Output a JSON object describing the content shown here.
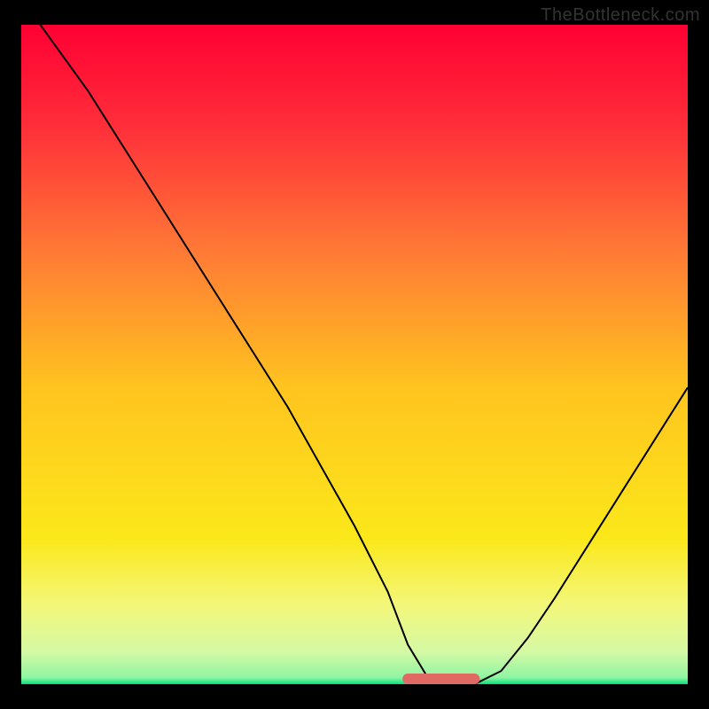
{
  "watermark": "TheBottleneck.com",
  "colors": {
    "page_bg": "#000000",
    "watermark": "#333333",
    "curve": "#000000",
    "optimal_marker": "#e06a63",
    "gradient_stops": [
      {
        "offset": "0%",
        "color": "#ff0033"
      },
      {
        "offset": "15%",
        "color": "#ff2d3a"
      },
      {
        "offset": "35%",
        "color": "#ff7c35"
      },
      {
        "offset": "55%",
        "color": "#ffc41f"
      },
      {
        "offset": "78%",
        "color": "#fbe81a"
      },
      {
        "offset": "88%",
        "color": "#f3f77a"
      },
      {
        "offset": "95%",
        "color": "#d6f9a4"
      },
      {
        "offset": "99%",
        "color": "#8ff5a3"
      },
      {
        "offset": "100%",
        "color": "#00e27a"
      }
    ]
  },
  "chart_data": {
    "type": "line",
    "title": "",
    "xlabel": "",
    "ylabel": "",
    "xlim": [
      0,
      100
    ],
    "ylim": [
      0,
      100
    ],
    "series": [
      {
        "name": "bottleneck-curve",
        "x": [
          0,
          5,
          10,
          15,
          20,
          25,
          30,
          35,
          40,
          45,
          50,
          55,
          58,
          61,
          64,
          68,
          72,
          76,
          80,
          85,
          90,
          95,
          100
        ],
        "values": [
          104,
          97,
          90,
          82,
          74,
          66,
          58,
          50,
          42,
          33,
          24,
          14,
          6,
          1,
          0,
          0,
          2,
          7,
          13,
          21,
          29,
          37,
          45
        ]
      }
    ],
    "annotations": {
      "optimal_range_x": [
        58,
        68
      ],
      "optimal_range_y": 0
    }
  }
}
